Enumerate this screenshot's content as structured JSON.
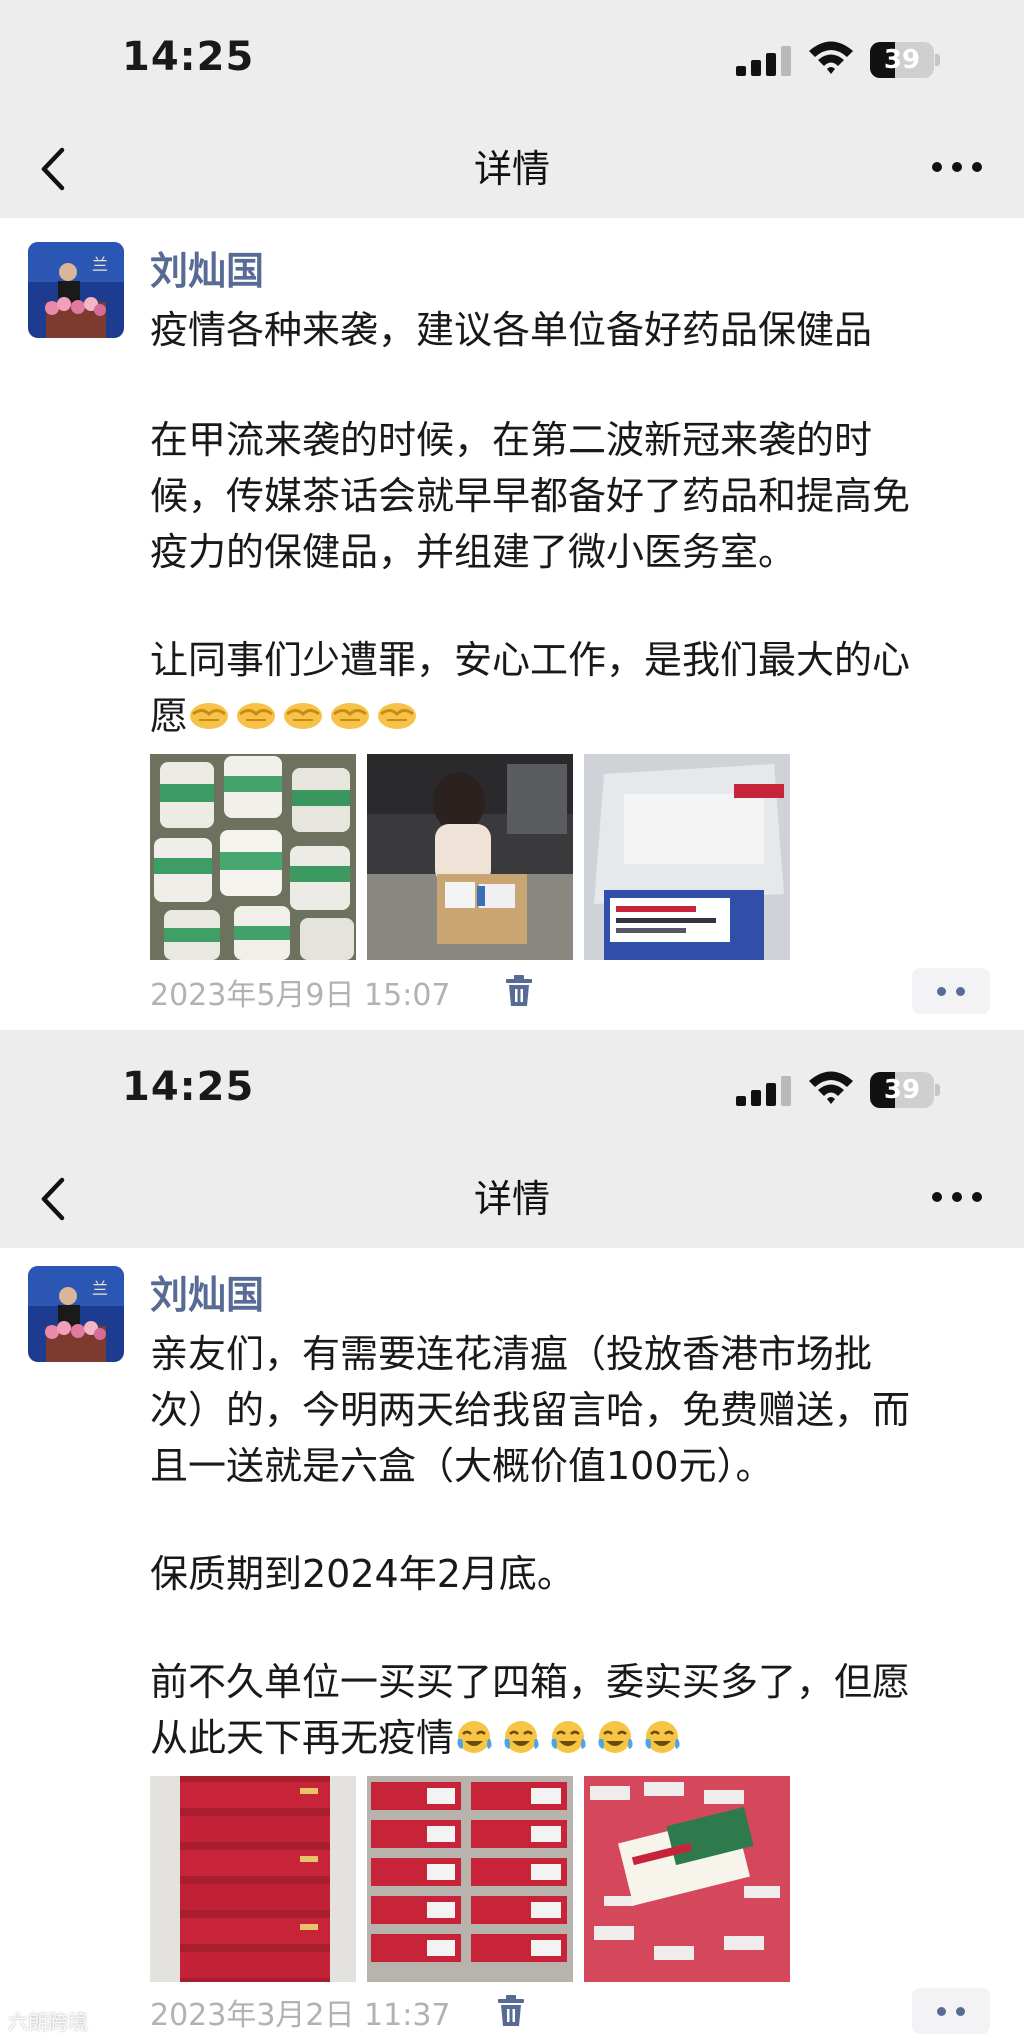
{
  "posts": [
    {
      "status_time": "14:25",
      "battery": "39",
      "nav_title": "详情",
      "author": "刘灿国",
      "text_lines": [
        "疫情各种来袭，建议各单位备好药品保健品",
        "在甲流来袭的时候，在第二波新冠来袭的时",
        "候，传媒茶话会就早早都备好了药品和提高免",
        "疫力的保健品，并组建了微小医务室。",
        "让同事们少遭罪，安心工作，是我们最大的心",
        "愿"
      ],
      "emoji_icon": "handshake-icon",
      "emoji_count": 5,
      "photo_subjects": [
        "medicine-bottles",
        "person-unpacking-box",
        "medicine-package-in-bag"
      ],
      "timestamp": "2023年5月9日 15:07"
    },
    {
      "status_time": "14:25",
      "battery": "39",
      "nav_title": "详情",
      "author": "刘灿国",
      "text_lines": [
        "亲友们，有需要连花清瘟（投放香港市场批",
        "次）的，今明两天给我留言哈，免费赠送，而",
        "且一送就是六盒（大概价值100元）。",
        "保质期到2024年2月底。",
        "前不久单位一买买了四箱，委实买多了，但愿",
        "从此天下再无疫情"
      ],
      "emoji_icon": "laughing-crying-icon",
      "emoji_count": 5,
      "photo_subjects": [
        "stacked-red-medicine-boxes",
        "stacked-medicine-boxes",
        "opened-medicine-box"
      ],
      "timestamp": "2023年3月2日 11:37"
    }
  ],
  "watermark": "六朗跨境",
  "colors": {
    "author": "#576b95",
    "meta": "#b2b2b2",
    "bar": "#ededed",
    "medicine_red": "#c7243a"
  }
}
